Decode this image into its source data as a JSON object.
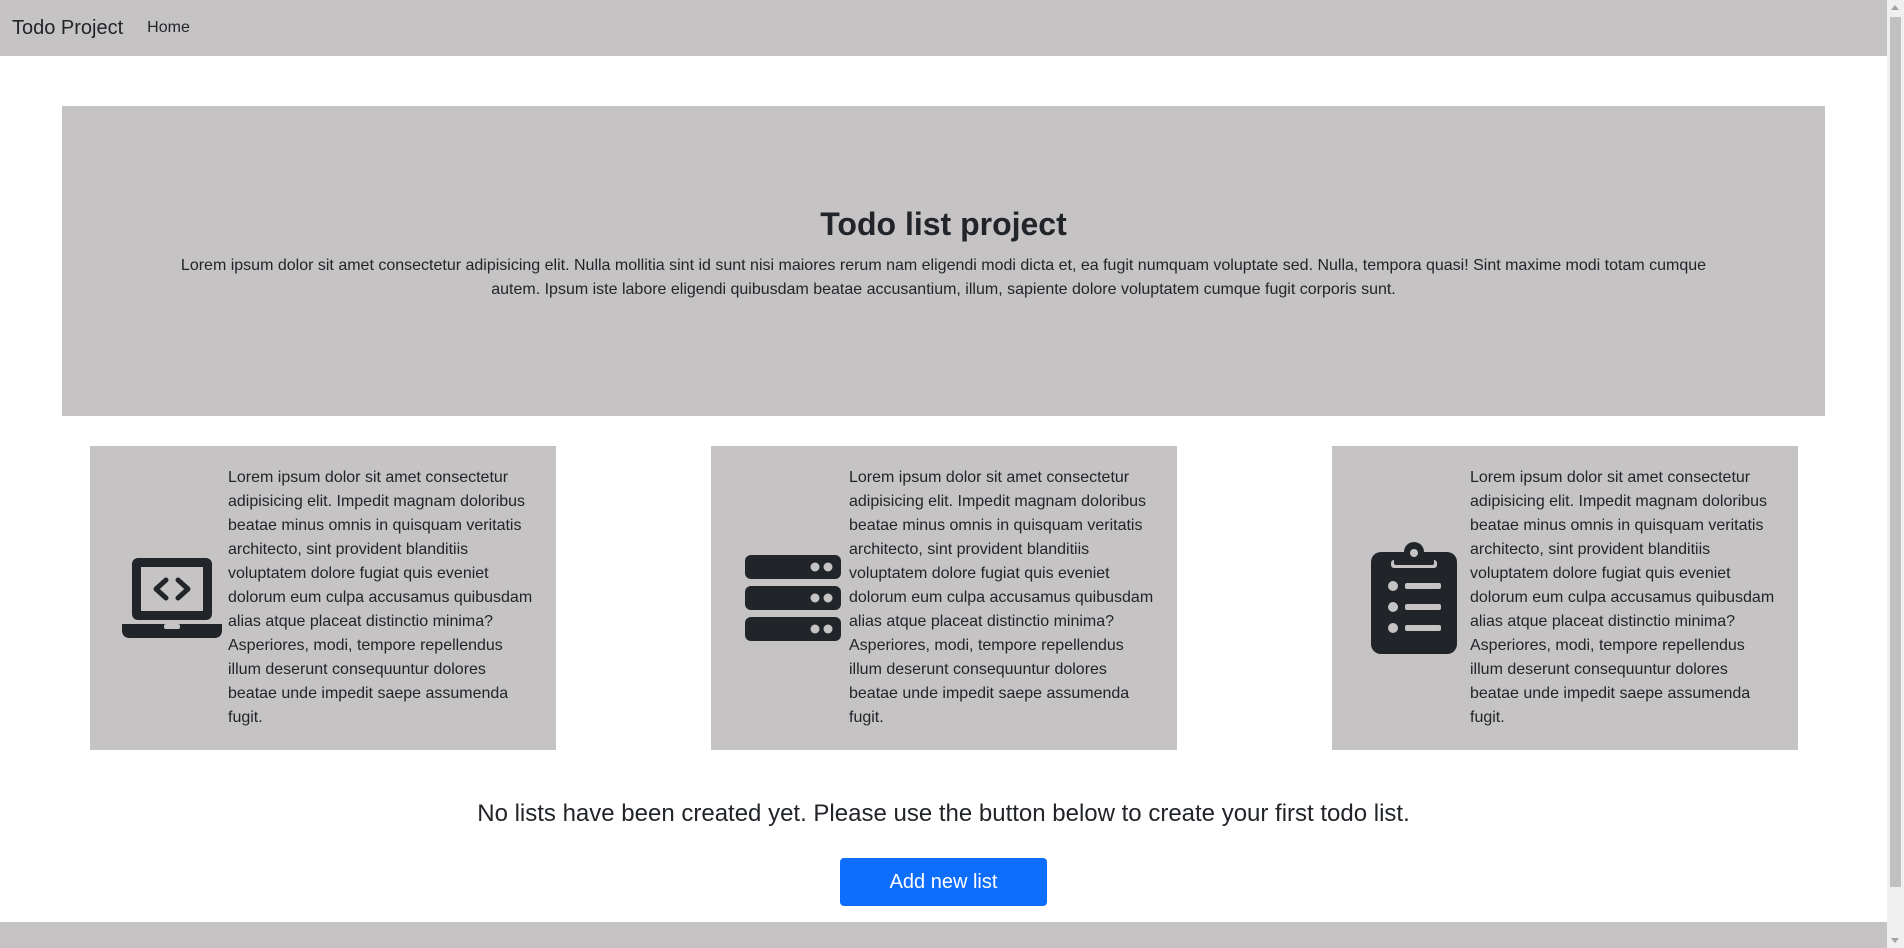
{
  "navbar": {
    "brand": "Todo Project",
    "links": [
      "Home"
    ]
  },
  "hero": {
    "title": "Todo list project",
    "text": "Lorem ipsum dolor sit amet consectetur adipisicing elit. Nulla mollitia sint id sunt nisi maiores rerum nam eligendi modi dicta et, ea fugit numquam voluptate sed. Nulla, tempora quasi! Sint maxime modi totam cumque autem. Ipsum iste labore eligendi quibusdam beatae accusantium, illum, sapiente dolore voluptatem cumque fugit corporis sunt."
  },
  "cards": [
    {
      "icon": "laptop-code-icon",
      "text": "Lorem ipsum dolor sit amet consectetur adipisicing elit. Impedit magnam doloribus beatae minus omnis in quisquam veritatis architecto, sint provident blanditiis voluptatem dolore fugiat quis eveniet dolorum eum culpa accusamus quibusdam alias atque placeat distinctio minima? Asperiores, modi, tempore repellendus illum deserunt consequuntur dolores beatae unde impedit saepe assumenda fugit."
    },
    {
      "icon": "server-icon",
      "text": "Lorem ipsum dolor sit amet consectetur adipisicing elit. Impedit magnam doloribus beatae minus omnis in quisquam veritatis architecto, sint provident blanditiis voluptatem dolore fugiat quis eveniet dolorum eum culpa accusamus quibusdam alias atque placeat distinctio minima? Asperiores, modi, tempore repellendus illum deserunt consequuntur dolores beatae unde impedit saepe assumenda fugit."
    },
    {
      "icon": "clipboard-list-icon",
      "text": "Lorem ipsum dolor sit amet consectetur adipisicing elit. Impedit magnam doloribus beatae minus omnis in quisquam veritatis architecto, sint provident blanditiis voluptatem dolore fugiat quis eveniet dolorum eum culpa accusamus quibusdam alias atque placeat distinctio minima? Asperiores, modi, tempore repellendus illum deserunt consequuntur dolores beatae unde impedit saepe assumenda fugit."
    }
  ],
  "empty_state": {
    "message": "No lists have been created yet. Please use the button below to create your first todo list.",
    "button_label": "Add new list"
  },
  "colors": {
    "surface": "#c5c3c4",
    "primary": "#0d6efd",
    "icon": "#212529",
    "text": "#212529"
  }
}
